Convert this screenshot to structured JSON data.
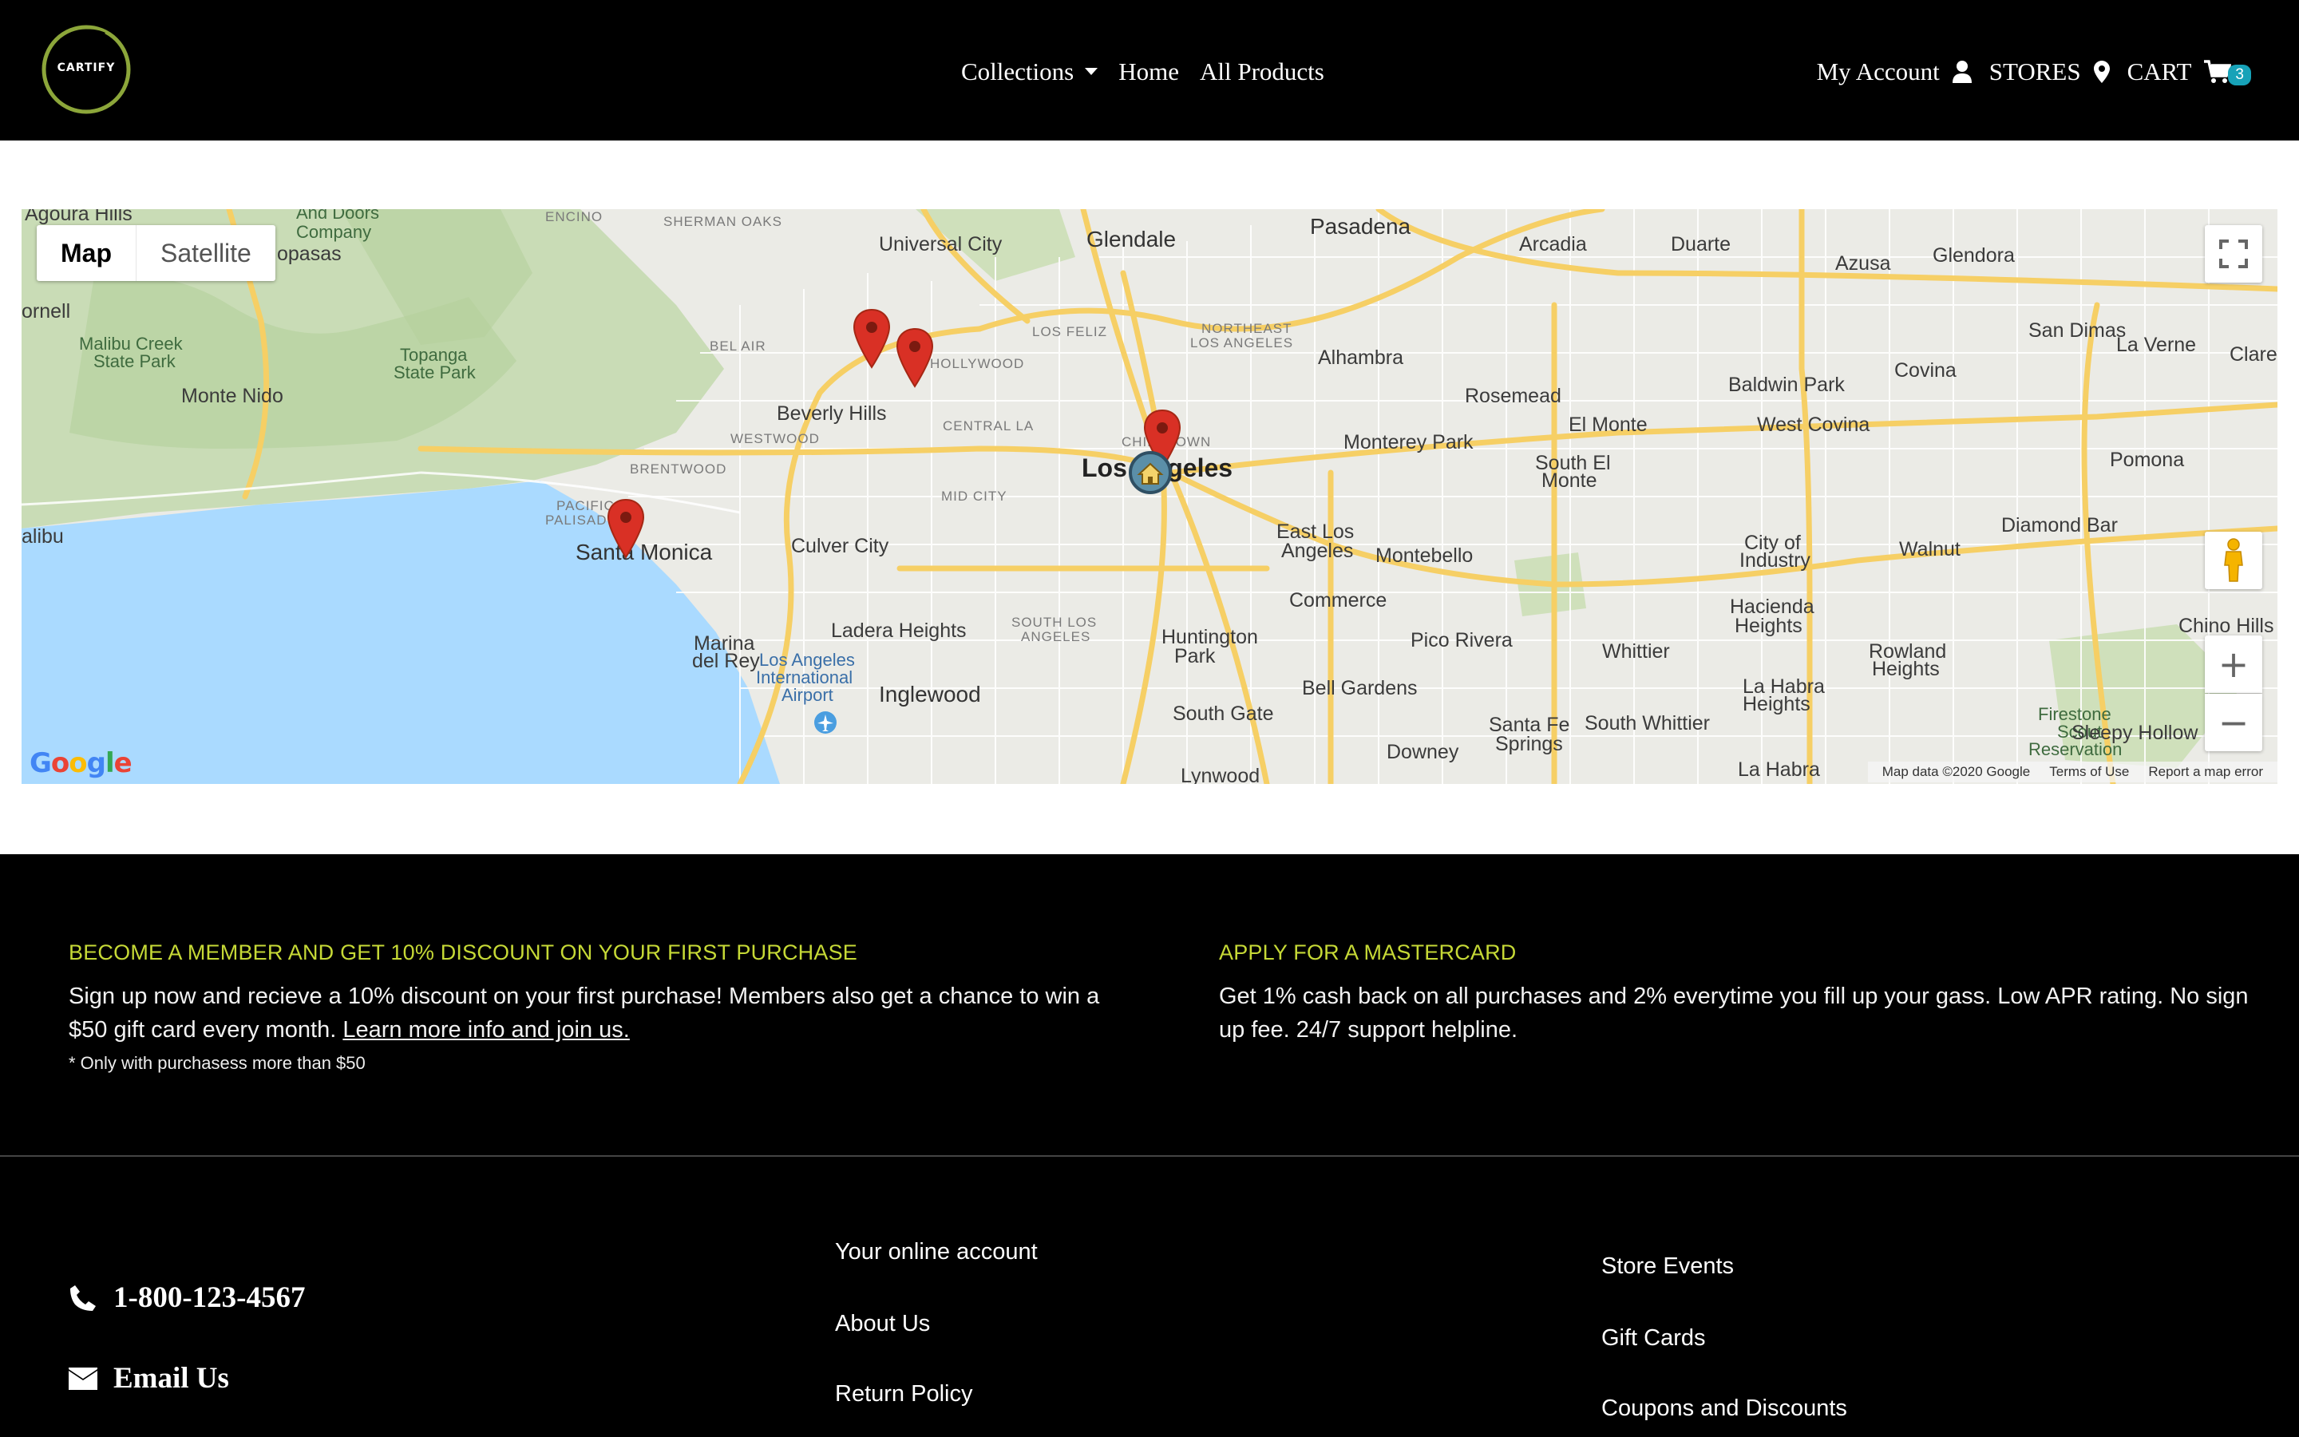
{
  "header": {
    "logo_text": "CARTIFY",
    "nav": {
      "collections": "Collections",
      "home": "Home",
      "all_products": "All Products"
    },
    "right": {
      "my_account": "My Account",
      "stores": "STORES",
      "cart": "CART",
      "cart_count": "3"
    }
  },
  "map": {
    "type_map": "Map",
    "type_satellite": "Satellite",
    "attribution": {
      "data": "Map data ©2020 Google",
      "terms": "Terms of Use",
      "report": "Report a map error"
    },
    "google_logo": "Google",
    "places": {
      "agoura": "Agoura Hills",
      "and_doors": "And Doors",
      "company": "Company",
      "encino": "ENCINO",
      "sherman_oaks": "SHERMAN OAKS",
      "universal_city": "Universal City",
      "glendale": "Glendale",
      "pasadena": "Pasadena",
      "arcadia": "Arcadia",
      "duarte": "Duarte",
      "azusa": "Azusa",
      "glendora": "Glendora",
      "opasas": "opasas",
      "ornell": "ornell",
      "malibu_creek": "Malibu Creek",
      "state_park1": "State Park",
      "topanga": "Topanga",
      "state_park2": "State Park",
      "bel_air": "BEL AIR",
      "hollywood": "HOLLYWOOD",
      "los_feliz": "LOS FELIZ",
      "northeast": "NORTHEAST",
      "northeast_la": "LOS ANGELES",
      "alhambra": "Alhambra",
      "san_dimas": "San Dimas",
      "la_verne": "La Verne",
      "claremont": "Claremo",
      "monte_nido": "Monte Nido",
      "beverly_hills": "Beverly Hills",
      "central_la": "CENTRAL LA",
      "rosemead": "Rosemead",
      "baldwin_park": "Baldwin Park",
      "covina": "Covina",
      "westwood": "WESTWOOD",
      "chinatown": "CHINATOWN",
      "monterey_park": "Monterey Park",
      "el_monte": "El Monte",
      "west_covina": "West Covina",
      "pomona": "Pomona",
      "brentwood": "BRENTWOOD",
      "los_angeles": "Los Angeles",
      "south_el_monte1": "South El",
      "south_el_monte2": "Monte",
      "alibu": "alibu",
      "pacific": "PACIFIC",
      "palisades": "PALISAD",
      "mid_city": "MID CITY",
      "santa_monica": "Santa Monica",
      "culver_city": "Culver City",
      "east_los": "East Los",
      "east_angeles": "Angeles",
      "montebello": "Montebello",
      "diamond_bar": "Diamond Bar",
      "city_of": "City of",
      "industry": "Industry",
      "walnut": "Walnut",
      "commerce": "Commerce",
      "south_los": "SOUTH LOS",
      "south_angeles": "ANGELES",
      "ladera": "Ladera Heights",
      "marina": "Marina",
      "del_rey": "del Rey",
      "lax1": "Los Angeles",
      "lax2": "International",
      "lax3": "Airport",
      "huntington": "Huntington",
      "park": "Park",
      "pico_rivera": "Pico Rivera",
      "whittier": "Whittier",
      "hacienda": "Hacienda",
      "heights": "Heights",
      "rowland": "Rowland",
      "rowland_heights": "Heights",
      "chino_hills": "Chino Hills",
      "inglewood": "Inglewood",
      "bell_gardens": "Bell Gardens",
      "south_gate": "South Gate",
      "santa_fe": "Santa Fe",
      "springs": "Springs",
      "south_whittier": "South Whittier",
      "la_habra_h": "La Habra",
      "la_habra_h2": "Heights",
      "firestone": "Firestone",
      "scout": "Scout",
      "reservation": "Reservation",
      "sleepy_hollow": "Sleepy Hollow",
      "downey": "Downey",
      "la_habra": "La Habra",
      "lynwood": "Lynwood"
    }
  },
  "promo": {
    "member": {
      "title": "BECOME A MEMBER AND GET 10% DISCOUNT ON YOUR FIRST PURCHASE",
      "body": "Sign up now and recieve a 10% discount on your first purchase! Members also get a chance to win a $50 gift card every month.",
      "link": "Learn more info and join us.",
      "note": "* Only with purchasess more than $50"
    },
    "mastercard": {
      "title": "APPLY FOR A MASTERCARD",
      "body": "Get 1% cash back on all purchases and 2% everytime you fill up your gass. Low APR rating. No sign up fee. 24/7 support helpline."
    }
  },
  "footer": {
    "phone": "1-800-123-4567",
    "email": "Email Us",
    "links_mid": [
      "Your online account",
      "About Us",
      "Return Policy"
    ],
    "links_right": [
      "Store Events",
      "Gift Cards",
      "Coupons and Discounts"
    ]
  },
  "colors": {
    "accent": "#c6d936",
    "badge": "#17a2b8",
    "marker": "#d93025"
  }
}
